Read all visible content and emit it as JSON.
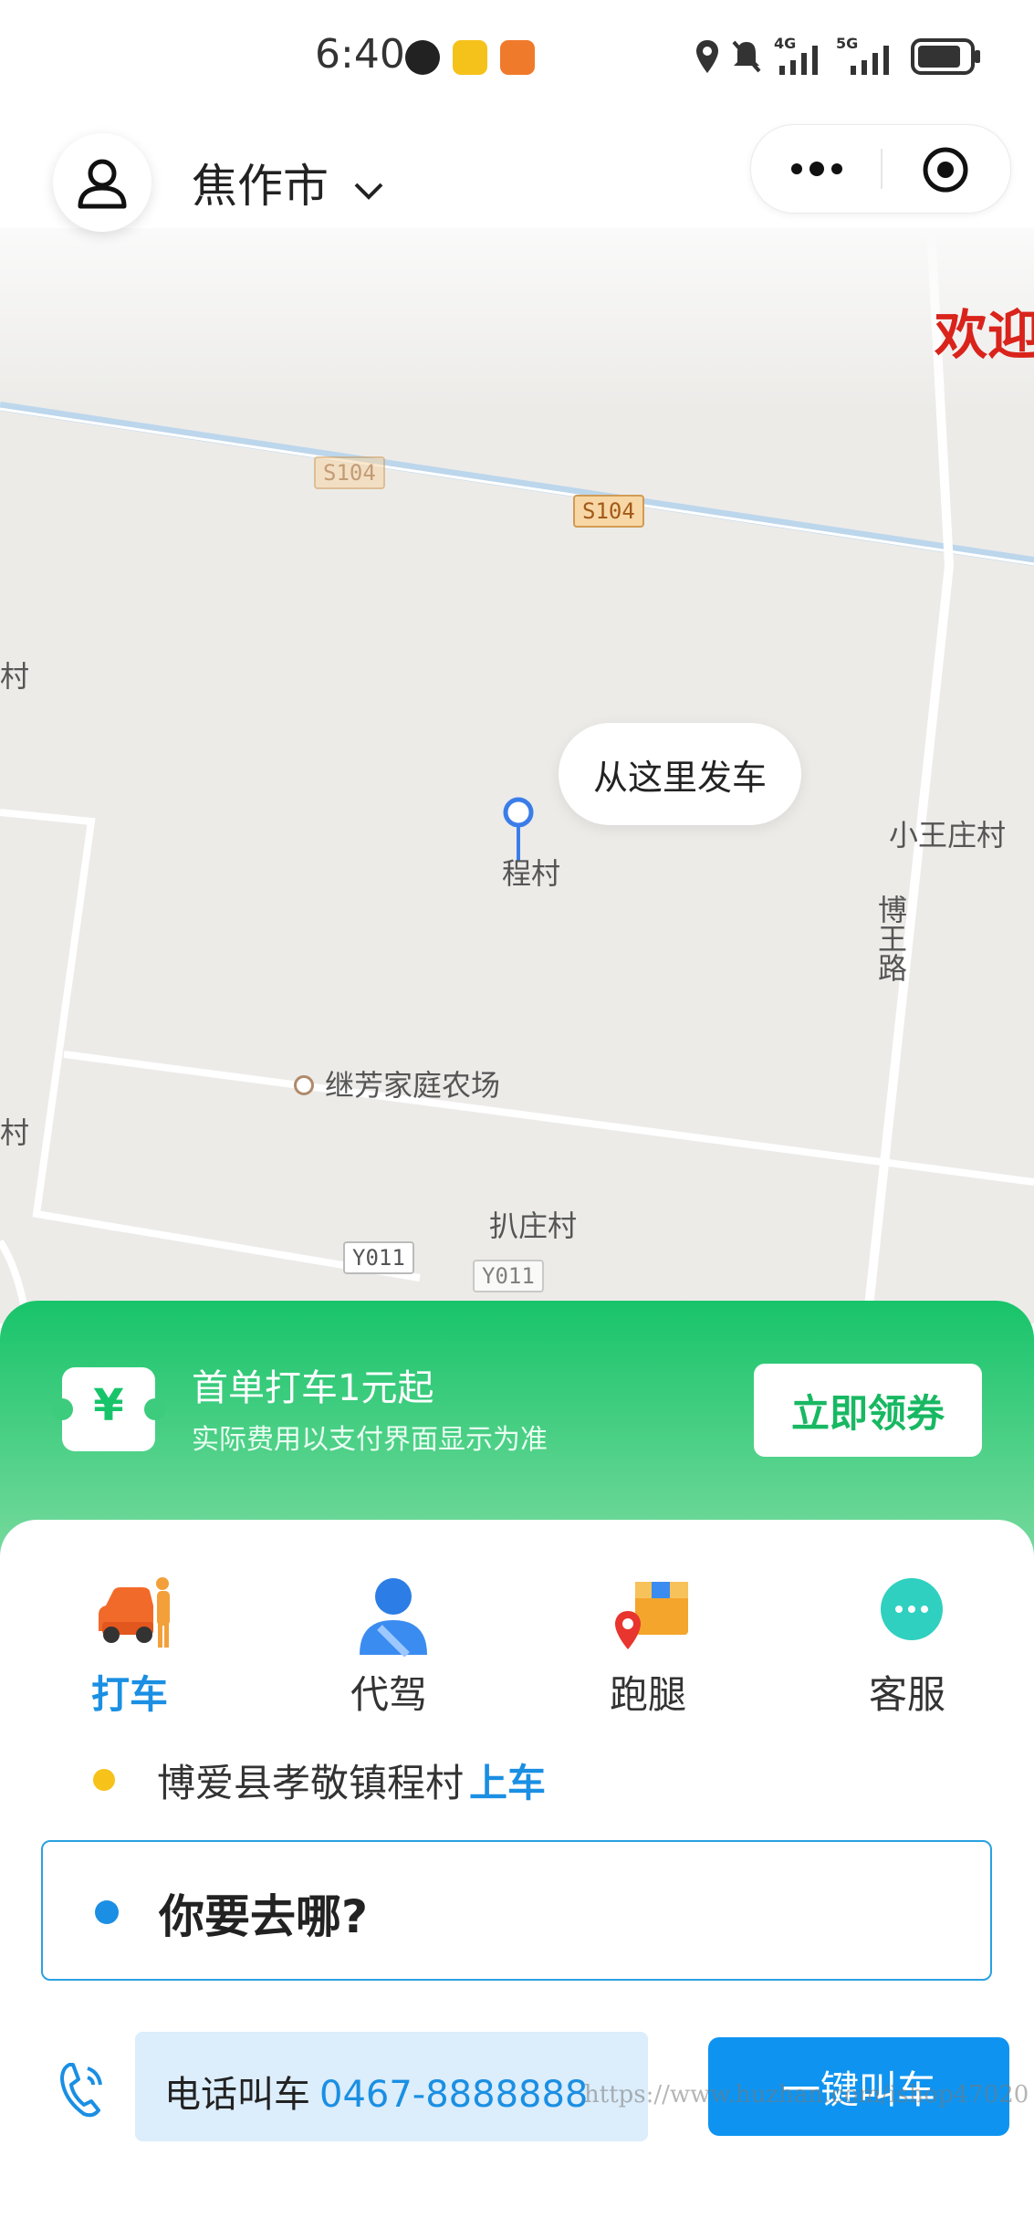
{
  "status_bar": {
    "time": "6:40",
    "network_1": "4G",
    "network_2": "5G"
  },
  "header": {
    "city": "焦作市"
  },
  "map": {
    "welcome_text": "欢迎",
    "pickup_bubble": "从这里发车",
    "pin_label": "程村",
    "labels": {
      "s104_a": "S104",
      "s104_b": "S104",
      "xiaowangzhuang": "小王庄村",
      "bowang_road": "博王路",
      "farm": "继芳家庭农场",
      "pazhuang": "扒庄村",
      "y011_a": "Y011",
      "y011_b": "Y011",
      "edge_left_1": "村",
      "edge_left_2": "村"
    }
  },
  "promo": {
    "title": "首单打车1元起",
    "subtitle": "实际费用以支付界面显示为准",
    "button": "立即领券",
    "coupon_symbol": "¥"
  },
  "services": [
    {
      "label": "打车",
      "icon": "taxi-icon"
    },
    {
      "label": "代驾",
      "icon": "chauffeur-icon"
    },
    {
      "label": "跑腿",
      "icon": "delivery-icon"
    },
    {
      "label": "客服",
      "icon": "support-icon"
    }
  ],
  "pickup": {
    "address": "博爱县孝敬镇程村",
    "action": "上车"
  },
  "destination": {
    "placeholder": "你要去哪?"
  },
  "phone_call": {
    "label": "电话叫车",
    "number": "0467-8888888"
  },
  "quick_call": {
    "button": "一键叫车"
  },
  "watermark": "https://www.huzhan.com/ishop47020",
  "colors": {
    "accent_blue": "#1a8fe3",
    "promo_green": "#18c46a",
    "pickup_yellow": "#f7c21a"
  }
}
